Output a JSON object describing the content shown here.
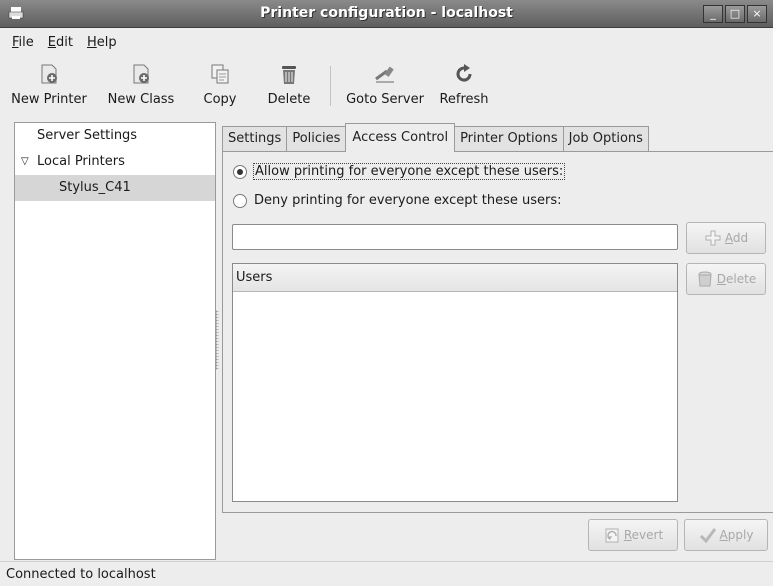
{
  "window": {
    "title": "Printer configuration - localhost",
    "minimize": "_",
    "maximize": "□",
    "close": "×"
  },
  "menu": {
    "file": {
      "mnemonic": "F",
      "rest": "ile"
    },
    "edit": {
      "mnemonic": "E",
      "rest": "dit"
    },
    "help": {
      "mnemonic": "H",
      "rest": "elp"
    }
  },
  "toolbar": {
    "new_printer": "New Printer",
    "new_class": "New Class",
    "copy": "Copy",
    "delete": "Delete",
    "goto_server": "Goto Server",
    "refresh": "Refresh"
  },
  "tree": {
    "server_settings": "Server Settings",
    "local_printers": "Local Printers",
    "printer": "Stylus_C41",
    "expander": "▽"
  },
  "tabs": [
    {
      "label": "Settings"
    },
    {
      "label": "Policies"
    },
    {
      "label": "Access Control"
    },
    {
      "label": "Printer Options"
    },
    {
      "label": "Job Options"
    }
  ],
  "access": {
    "allow_label": "Allow printing for everyone except these users:",
    "deny_label": "Deny printing for everyone except these users:",
    "selected": "allow",
    "user_input_value": "",
    "add_label": {
      "mnemonic": "A",
      "rest": "dd"
    },
    "delete_label": {
      "mnemonic": "D",
      "rest": "elete"
    },
    "users_column": "Users"
  },
  "actions": {
    "revert": {
      "mnemonic": "R",
      "rest": "evert"
    },
    "apply": {
      "mnemonic": "A",
      "rest": "pply"
    }
  },
  "status": "Connected to localhost",
  "colors": {
    "selection": "#d6d6d6",
    "disabled_text": "#a8a8a8"
  }
}
